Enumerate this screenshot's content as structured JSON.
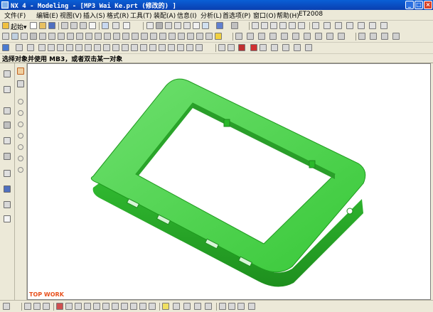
{
  "window": {
    "title": "NX 4 - Modeling - [MP3 Wai Ke.prt  (修改的) ]",
    "minimize_glyph": "_",
    "maximize_glyph": "□",
    "close_glyph": "×"
  },
  "menu": [
    "文件(F)",
    "编辑(E)",
    "视图(V)",
    "插入(S)",
    "格式(R)",
    "工具(T)",
    "装配(A)",
    "信息(I)",
    "分析(L)",
    "首选项(P)",
    "窗口(O)",
    "帮助(H)",
    "ET2008"
  ],
  "toolbar": {
    "start_label": "起始▾"
  },
  "prompt": {
    "text": "选择对象并使用 MB3，或者双击某一对象"
  },
  "viewport": {
    "label": "TOP WORK",
    "part_color": "#3fd63f",
    "background": "#ffffff"
  },
  "colors": {
    "title_bar": "#0a4fc4",
    "accent_orange": "#e8501c",
    "model_green": "#3fd63f"
  }
}
